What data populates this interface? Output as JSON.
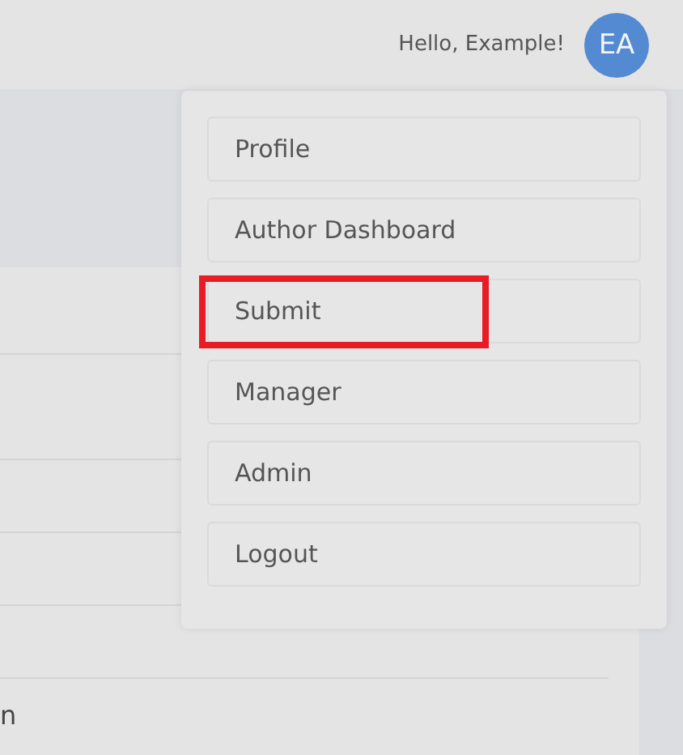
{
  "header": {
    "greeting": "Hello, Example!",
    "avatar_initials": "EA"
  },
  "user_menu": {
    "items": [
      {
        "label": "Profile",
        "highlighted": false
      },
      {
        "label": "Author Dashboard",
        "highlighted": false
      },
      {
        "label": "Submit",
        "highlighted": true
      },
      {
        "label": "Manager",
        "highlighted": false
      },
      {
        "label": "Admin",
        "highlighted": false
      },
      {
        "label": "Logout",
        "highlighted": false
      }
    ]
  },
  "background_list": {
    "cut_text": "n"
  }
}
